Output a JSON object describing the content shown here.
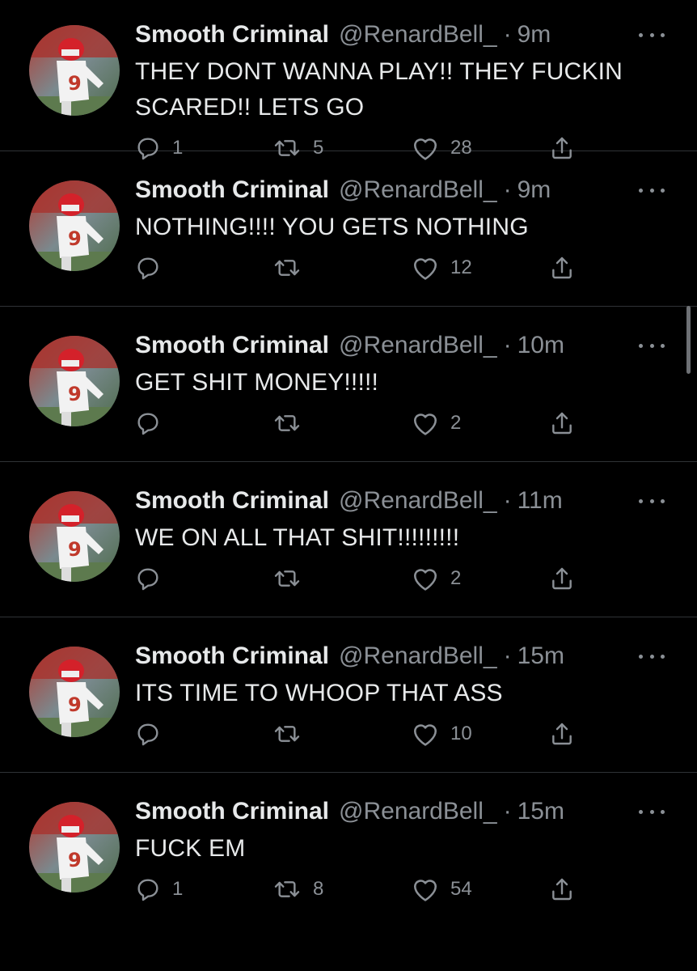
{
  "tweets": [
    {
      "name": "Smooth Criminal",
      "handle": "@RenardBell_",
      "separator": "·",
      "time": "9m",
      "text": "THEY DONT WANNA PLAY!! THEY FUCKIN SCARED!! LETS GO",
      "replies": "1",
      "retweets": "5",
      "likes": "28"
    },
    {
      "name": "Smooth Criminal",
      "handle": "@RenardBell_",
      "separator": "·",
      "time": "9m",
      "text": "NOTHING!!!! YOU GETS NOTHING",
      "replies": "",
      "retweets": "",
      "likes": "12"
    },
    {
      "name": "Smooth Criminal",
      "handle": "@RenardBell_",
      "separator": "·",
      "time": "10m",
      "text": "GET SHIT MONEY!!!!!",
      "replies": "",
      "retweets": "",
      "likes": "2"
    },
    {
      "name": "Smooth Criminal",
      "handle": "@RenardBell_",
      "separator": "·",
      "time": "11m",
      "text": "WE ON ALL THAT SHIT!!!!!!!!!",
      "replies": "",
      "retweets": "",
      "likes": "2"
    },
    {
      "name": "Smooth Criminal",
      "handle": "@RenardBell_",
      "separator": "·",
      "time": "15m",
      "text": "ITS TIME TO WHOOP THAT ASS",
      "replies": "",
      "retweets": "",
      "likes": "10"
    },
    {
      "name": "Smooth Criminal",
      "handle": "@RenardBell_",
      "separator": "·",
      "time": "15m",
      "text": "FUCK EM",
      "replies": "1",
      "retweets": "8",
      "likes": "54"
    }
  ],
  "icons": {
    "reply": "reply-icon",
    "retweet": "retweet-icon",
    "like": "heart-icon",
    "share": "share-icon",
    "more": "more-icon",
    "avatar": "avatar-football-player"
  },
  "colors": {
    "background": "#000000",
    "text": "#e7e9ea",
    "secondary": "#8b9096",
    "divider": "#2f3336",
    "avatar_red": "#c0392b"
  }
}
